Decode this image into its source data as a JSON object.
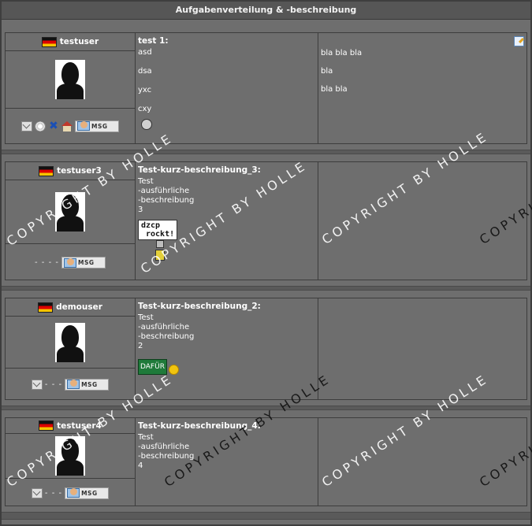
{
  "header": {
    "title": "Aufgabenverteilung & -beschreibung"
  },
  "watermark": "COPYRIGHT BY HOLLE",
  "posts": [
    {
      "user": "testuser",
      "title": "test 1:",
      "lines": [
        "asd",
        "dsa",
        "yxc",
        "cxy"
      ],
      "right_lines": [
        "bla bla bla",
        "bla",
        "bla bla"
      ],
      "msg_label": "MSG"
    },
    {
      "user": "testuser3",
      "title": "Test-kurz-beschreibung_3:",
      "lines": [
        "Test",
        "-ausführliche",
        "-beschreibung",
        "3"
      ],
      "sign_line1": "dzcp",
      "sign_line2": "rockt!",
      "dashes": "- - - -",
      "msg_label": "MSG"
    },
    {
      "user": "demouser",
      "title": "Test-kurz-beschreibung_2:",
      "lines": [
        "Test",
        "-ausführliche",
        "-beschreibung",
        "2"
      ],
      "sign_text": "DAFÜR",
      "dashes": "- - -",
      "msg_label": "MSG"
    },
    {
      "user": "testuser4",
      "title": "Test-kurz-beschreibung_4:",
      "lines": [
        "Test",
        "-ausführliche",
        "-beschreibung",
        "4"
      ],
      "dashes": "- - -",
      "msg_label": "MSG"
    }
  ]
}
